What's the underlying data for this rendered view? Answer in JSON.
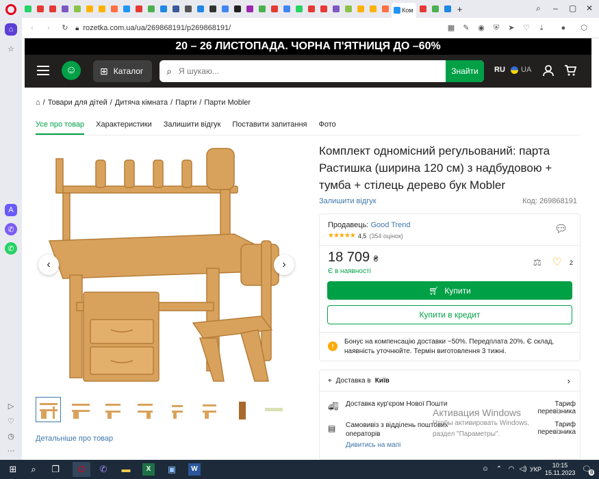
{
  "browser": {
    "tabs_count": 34,
    "active_tab_label": "Ком",
    "url": "rozetka.com.ua/ua/269868191/p269868191/",
    "url_host": "rozetka.com.ua",
    "url_path": "/ua/269868191/p269868191/"
  },
  "promo": {
    "text": "20 – 26 ЛИСТОПАДА. ЧОРНА П'ЯТНИЦЯ ДО –60%"
  },
  "header": {
    "catalog_label": "Каталог",
    "search_placeholder": "Я шукаю...",
    "search_button": "Знайти",
    "lang_ru": "RU",
    "lang_ua": "UA"
  },
  "breadcrumbs": [
    "Товари для дітей",
    "Дитяча кімната",
    "Парти",
    "Парти Mobler"
  ],
  "tabs": [
    "Усе про товар",
    "Характеристики",
    "Залишити відгук",
    "Поставити запитання",
    "Фото"
  ],
  "product": {
    "title": "Комплект одномісний регульований: парта Растишка (ширина 120 см) з надбудовою + тумба + стілець дерево бук Mobler",
    "leave_review": "Залишити відгук",
    "code_label": "Код:",
    "code": "269868191",
    "seller_label": "Продавець:",
    "seller_name": "Good Trend",
    "rating_value": "4,5",
    "rating_count": "(354 оцінок)",
    "rating_stars": 4.5,
    "price": "18 709",
    "currency": "₴",
    "availability": "Є в наявності",
    "wishlist_count": "2",
    "buy_label": "Купити",
    "credit_label": "Купити в кредит",
    "note": "Бонус на компенсацію доставки −50%. Передплата 20%. Є склад, наявність уточнюйте. Термін виготовлення 3 тижні.",
    "more_about": "Детальніше про товар"
  },
  "delivery": {
    "title_prefix": "Доставка в",
    "city": "Київ",
    "rows": [
      {
        "label": "Доставка кур'єром Нової Пошти",
        "value": "Тариф перевізника"
      },
      {
        "label": "Самовивіз з відділень поштових операторів",
        "value": "Тариф перевізника"
      }
    ],
    "map_link": "Дивитись на мапі"
  },
  "watermark": {
    "title": "Активация Windows",
    "line1": "Чтобы активировать Windows,",
    "line2": "раздел \"Параметры\"."
  },
  "taskbar": {
    "lang": "УКР",
    "time": "10:15",
    "date": "15.11.2023",
    "notif_count": "8"
  },
  "colors": {
    "brand_green": "#00a046",
    "dark": "#221f1f",
    "link": "#3e77aa",
    "star": "#ffa900"
  }
}
